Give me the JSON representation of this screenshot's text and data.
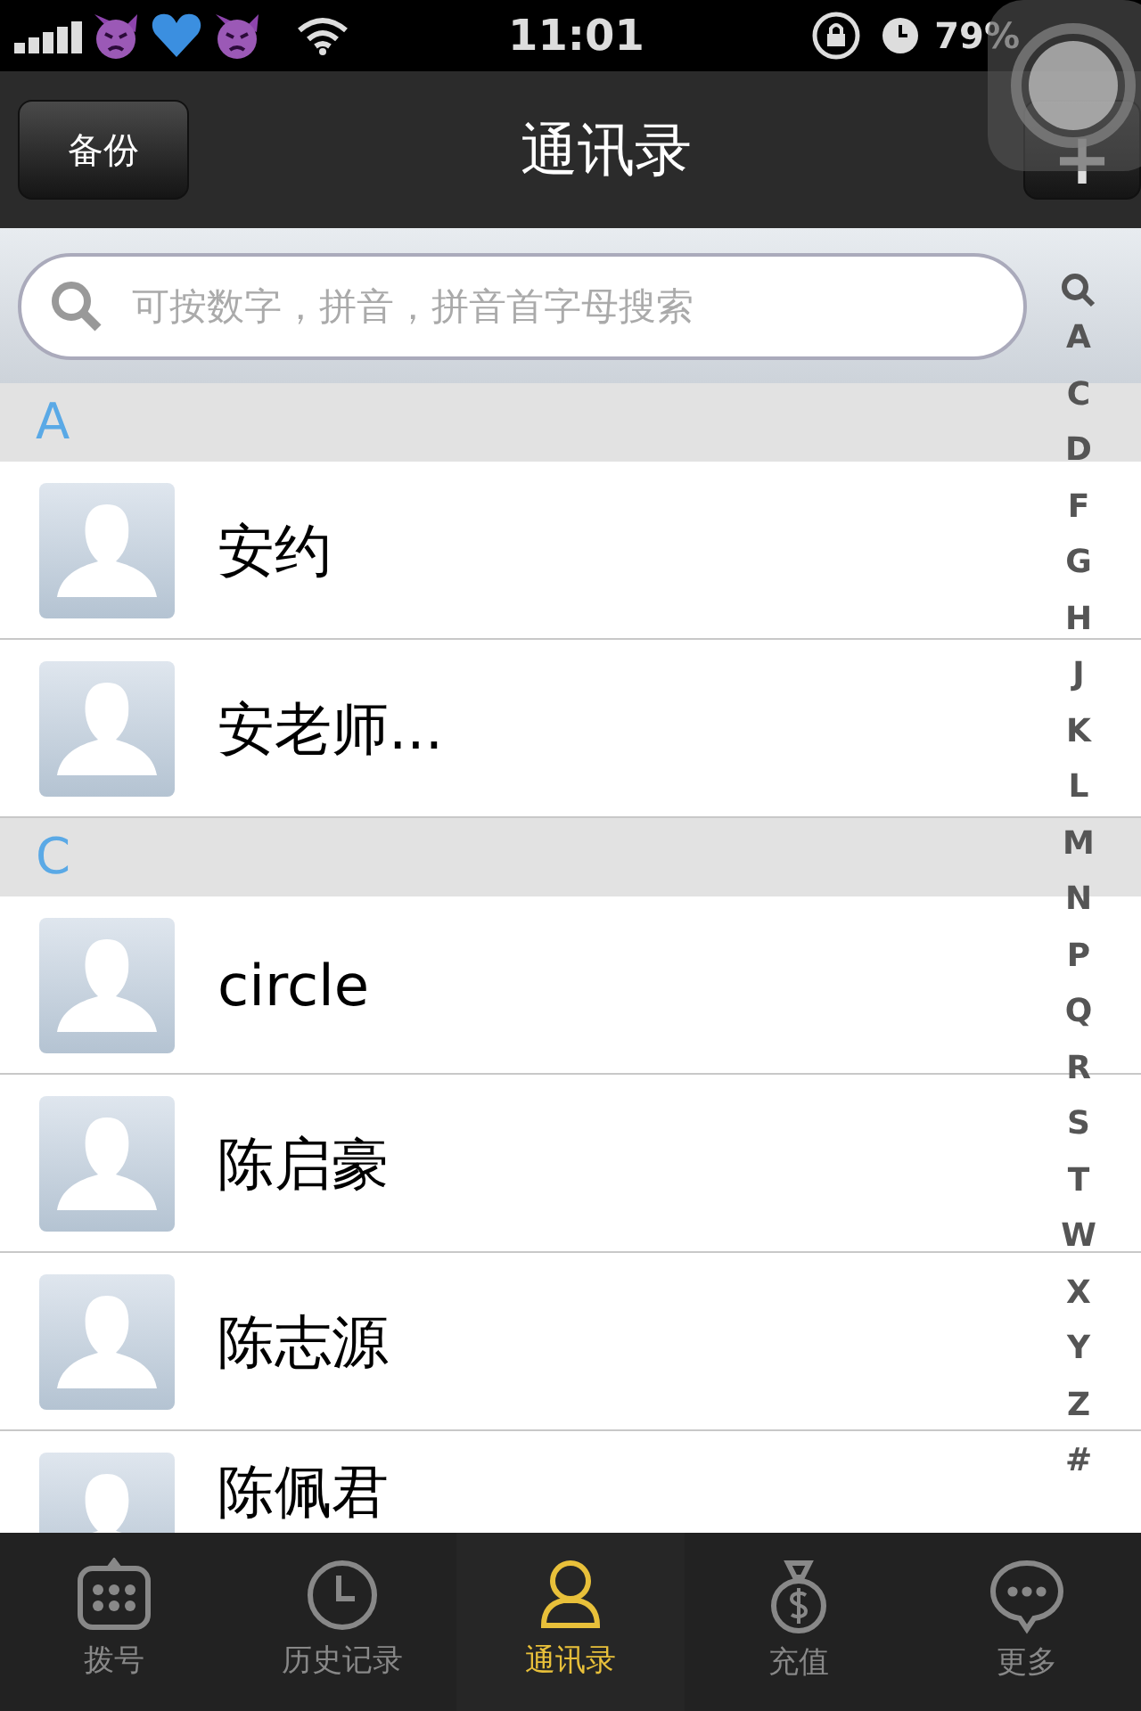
{
  "status_bar": {
    "time": "11:01",
    "battery": "79%"
  },
  "nav_bar": {
    "left_button": "备份",
    "title": "通讯录",
    "right_button": "+"
  },
  "search": {
    "placeholder": "可按数字，拼音，拼音首字母搜索"
  },
  "index": [
    "A",
    "C",
    "D",
    "F",
    "G",
    "H",
    "J",
    "K",
    "L",
    "M",
    "N",
    "P",
    "Q",
    "R",
    "S",
    "T",
    "W",
    "X",
    "Y",
    "Z",
    "#"
  ],
  "sections": [
    {
      "letter": "A",
      "contacts": [
        {
          "name": "安约"
        },
        {
          "name": "安老师..."
        }
      ]
    },
    {
      "letter": "C",
      "contacts": [
        {
          "name": "circle"
        },
        {
          "name": "陈启豪"
        },
        {
          "name": "陈志源"
        },
        {
          "name": "陈佩君"
        }
      ]
    }
  ],
  "tab_bar": [
    {
      "label": "拨号",
      "selected": false
    },
    {
      "label": "历史记录",
      "selected": false
    },
    {
      "label": "通讯录",
      "selected": true
    },
    {
      "label": "充值",
      "selected": false
    },
    {
      "label": "更多",
      "selected": false
    }
  ]
}
